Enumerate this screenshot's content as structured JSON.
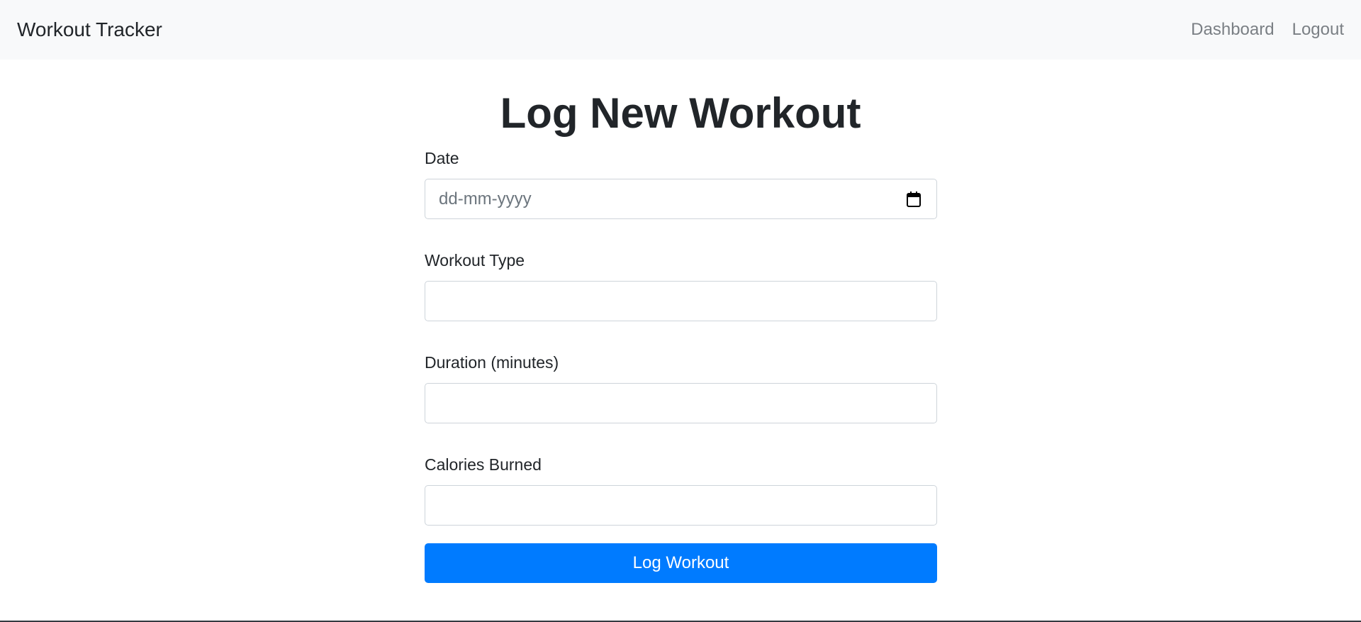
{
  "navbar": {
    "brand": "Workout Tracker",
    "links": [
      {
        "label": "Dashboard"
      },
      {
        "label": "Logout"
      }
    ]
  },
  "page": {
    "title": "Log New Workout"
  },
  "form": {
    "date": {
      "label": "Date",
      "placeholder": "dd-mm-yyyy",
      "value": ""
    },
    "workout_type": {
      "label": "Workout Type",
      "value": ""
    },
    "duration": {
      "label": "Duration (minutes)",
      "value": ""
    },
    "calories": {
      "label": "Calories Burned",
      "value": ""
    },
    "submit_label": "Log Workout"
  },
  "icons": {
    "date_picker": "calendar-icon"
  },
  "colors": {
    "navbar_bg": "#f8f9fa",
    "primary": "#007bff",
    "text": "#212529",
    "muted_link": "#7a7f84"
  }
}
